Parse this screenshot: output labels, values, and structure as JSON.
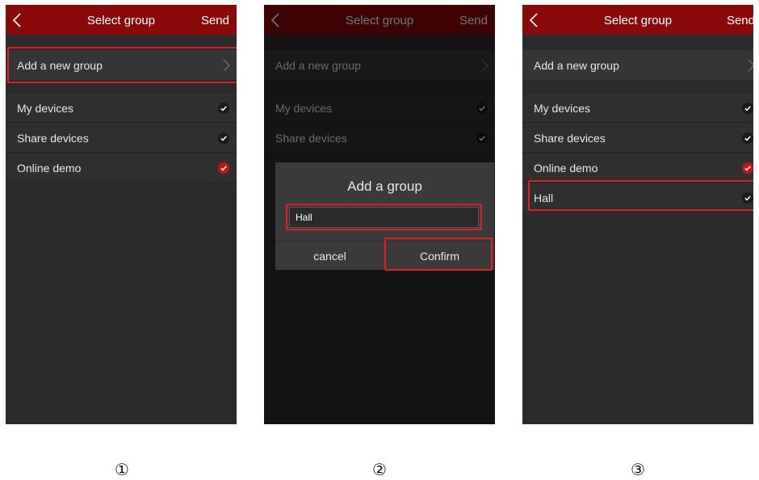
{
  "header": {
    "title": "Select group",
    "send_label": "Send"
  },
  "list": {
    "add_new_group": "Add a new group",
    "groups": [
      {
        "label": "My devices",
        "checked": false
      },
      {
        "label": "Share devices",
        "checked": false
      },
      {
        "label": "Online demo",
        "checked": true
      },
      {
        "label": "Hall",
        "checked": false
      }
    ]
  },
  "dialog": {
    "title": "Add a group",
    "input_value": "Hall",
    "cancel_label": "cancel",
    "confirm_label": "Confirm"
  },
  "step_markers": [
    "①",
    "②",
    "③"
  ],
  "colors": {
    "topbar": "#8a0a0a",
    "background": "#2b2b2b",
    "highlight": "#e02020",
    "check_selected": "#c0141a",
    "check_unselected": "#1a1a1a"
  },
  "icons": {
    "back": "back-chevron-icon",
    "forward": "chevron-right-icon",
    "check": "check-icon"
  }
}
